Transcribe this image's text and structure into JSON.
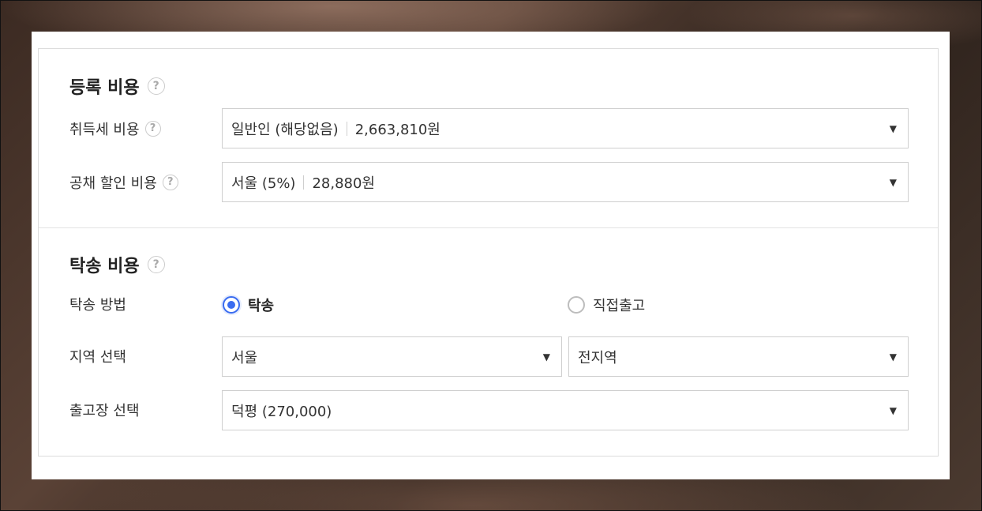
{
  "registration": {
    "title": "등록 비용",
    "acquisition_tax": {
      "label": "취득세 비용",
      "selected": "일반인 (해당없음)",
      "amount": "2,663,810원"
    },
    "bond_discount": {
      "label": "공채 할인 비용",
      "selected": "서울 (5%)",
      "amount": "28,880원"
    }
  },
  "shipping": {
    "title": "탁송 비용",
    "method": {
      "label": "탁송 방법",
      "options": [
        "탁송",
        "직접출고"
      ],
      "selected": "탁송"
    },
    "region": {
      "label": "지역 선택",
      "city": "서울",
      "district": "전지역"
    },
    "depot": {
      "label": "출고장 선택",
      "selected": "덕평 (270,000)"
    }
  },
  "icons": {
    "help": "?",
    "caret": "▼"
  },
  "colors": {
    "accent": "#3a6cf0"
  }
}
